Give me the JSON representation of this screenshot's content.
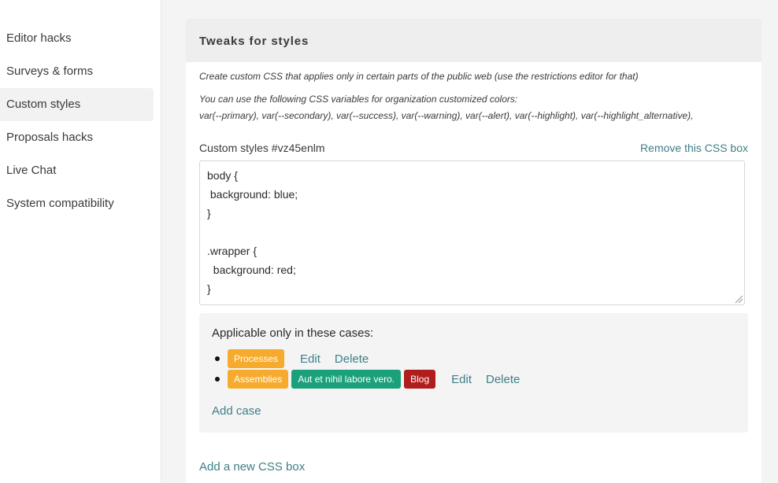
{
  "sidebar": {
    "items": [
      {
        "label": "Editor hacks",
        "active": false
      },
      {
        "label": "Surveys & forms",
        "active": false
      },
      {
        "label": "Custom styles",
        "active": true
      },
      {
        "label": "Proposals hacks",
        "active": false
      },
      {
        "label": "Live Chat",
        "active": false
      },
      {
        "label": "System compatibility",
        "active": false
      }
    ]
  },
  "card": {
    "title": "Tweaks for styles",
    "help_text": "Create custom CSS that applies only in certain parts of the public web (use the restrictions editor for that)",
    "variables_intro": "You can use the following CSS variables for organization customized colors:",
    "variables_list": "var(--primary), var(--secondary), var(--success), var(--warning), var(--alert), var(--highlight), var(--highlight_alternative),"
  },
  "css_box": {
    "label": "Custom styles #vz45enlm",
    "remove_label": "Remove this CSS box",
    "code_lines": [
      "body {",
      " background: blue;",
      "}",
      "",
      ".wrapper {",
      "  background: red;",
      "}"
    ]
  },
  "cases": {
    "title": "Applicable only in these cases:",
    "rows": [
      {
        "tags": [
          {
            "label": "Processes",
            "color": "#f6ab2e"
          }
        ],
        "edit_label": "Edit",
        "delete_label": "Delete"
      },
      {
        "tags": [
          {
            "label": "Assemblies",
            "color": "#f6ab2e"
          },
          {
            "label": "Aut et nihil labore vero.",
            "color": "#1aa17b"
          },
          {
            "label": "Blog",
            "color": "#b01d1d"
          }
        ],
        "edit_label": "Edit",
        "delete_label": "Delete"
      }
    ],
    "add_case_label": "Add case"
  },
  "add_box_label": "Add a new CSS box",
  "colors": {
    "link": "#3e7f88",
    "orange_tag": "#f6ab2e",
    "green_tag": "#1aa17b",
    "red_tag": "#b01d1d"
  }
}
